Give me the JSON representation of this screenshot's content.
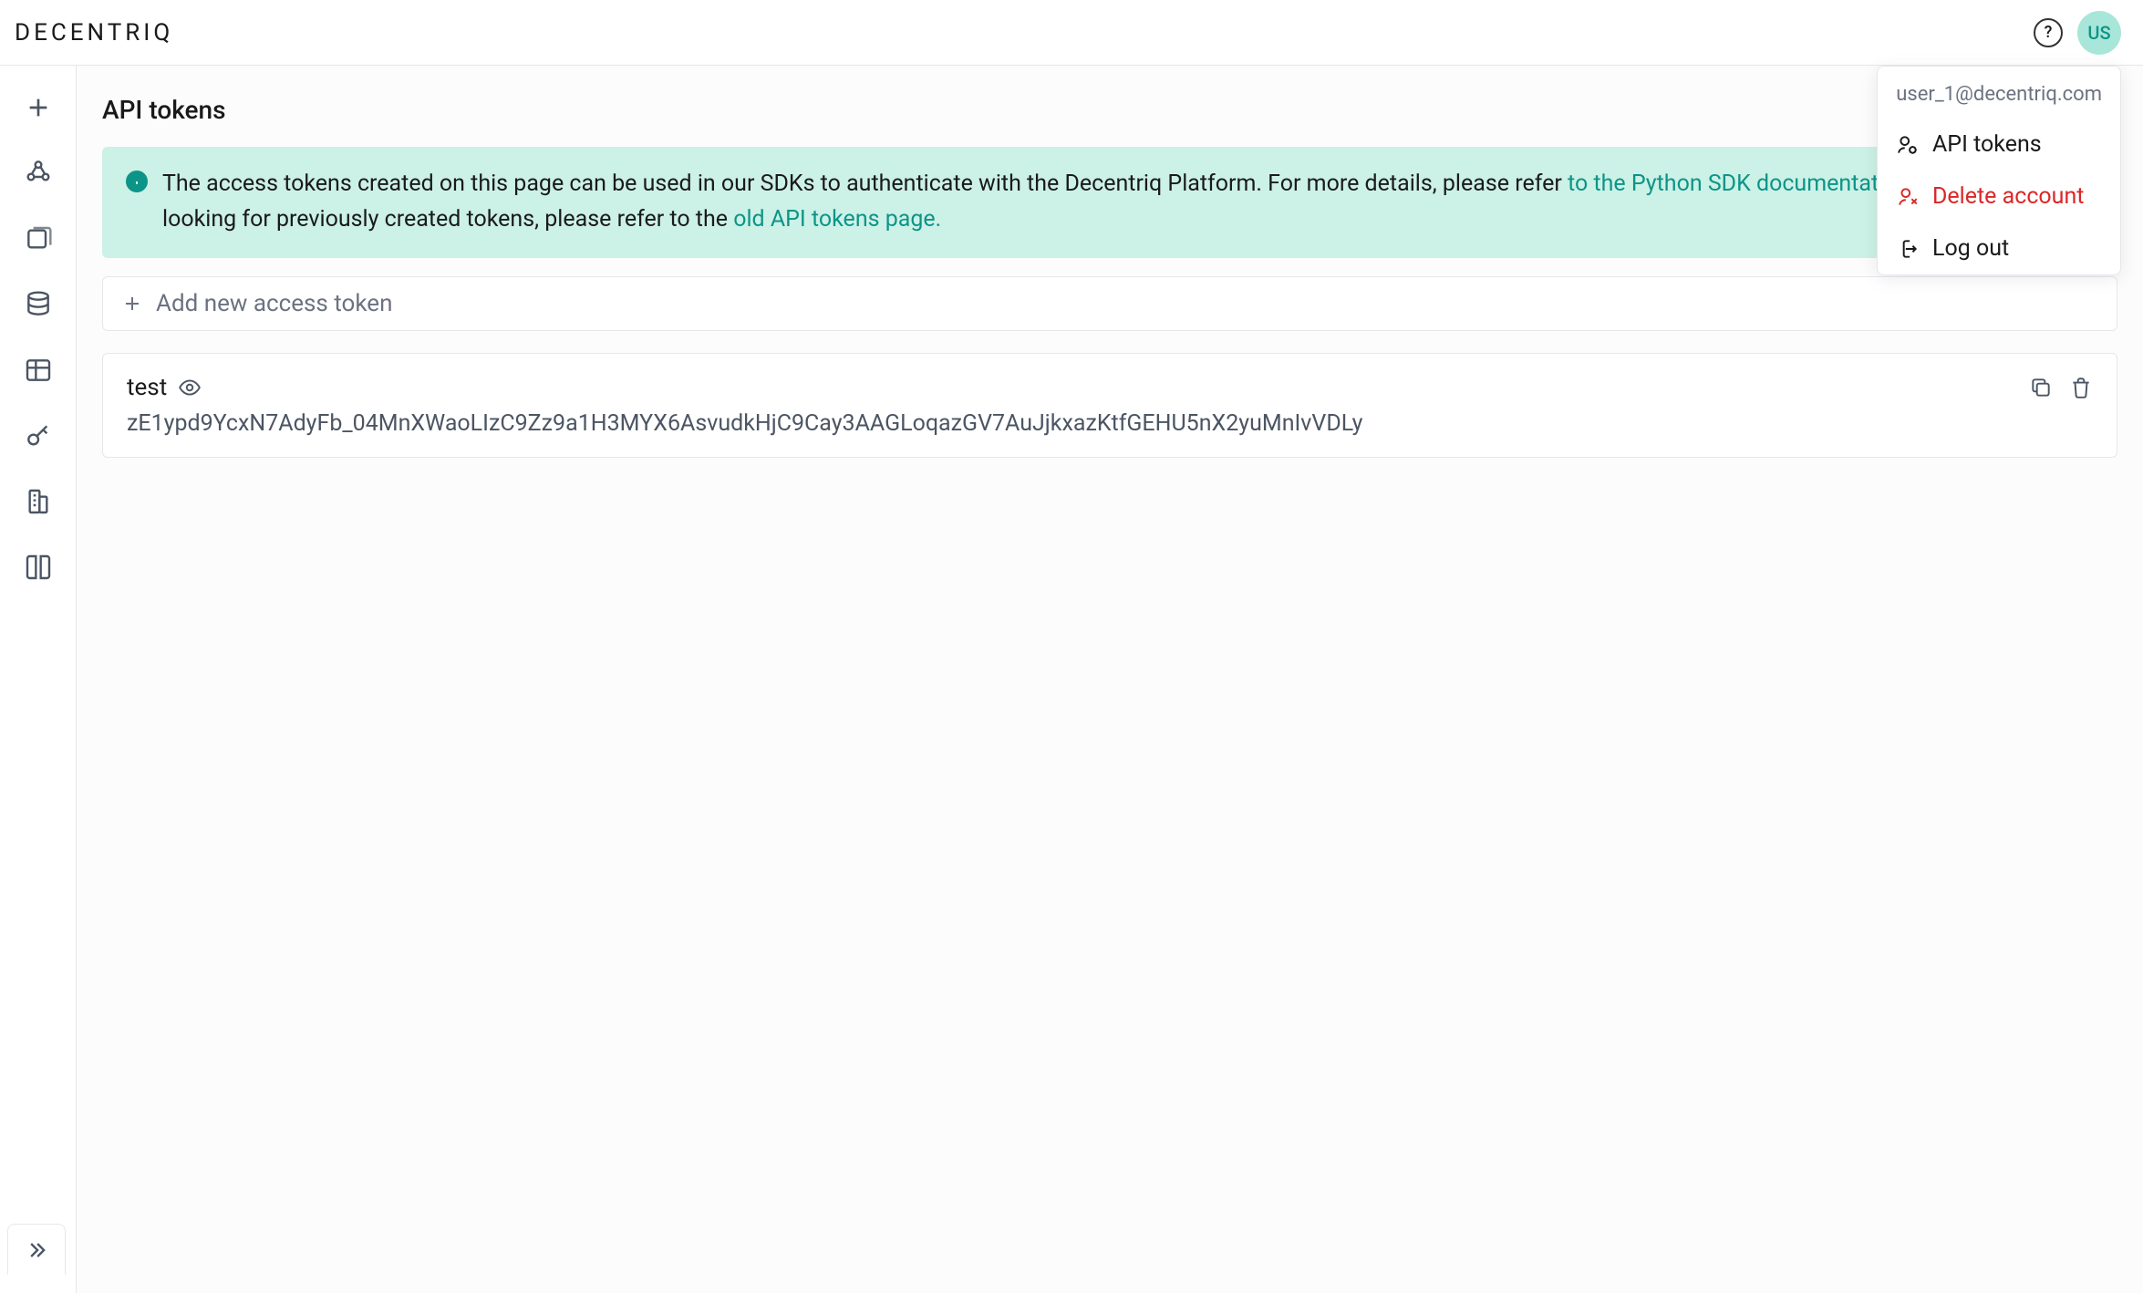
{
  "brand": "DECENTRIQ",
  "header": {
    "avatar_initials": "US"
  },
  "dropdown": {
    "email": "user_1@decentriq.com",
    "api_tokens": "API tokens",
    "delete_account": "Delete account",
    "log_out": "Log out"
  },
  "page": {
    "title": "API tokens"
  },
  "banner": {
    "part1": "The access tokens created on this page can be used in our SDKs to authenticate with the Decentriq Platform. For more details, please refer ",
    "link1": "to the Python SDK documentation.",
    "part2": " If you are looking for previously created tokens, please refer to the ",
    "link2": "old API tokens page."
  },
  "add_token_label": "Add new access token",
  "tokens": [
    {
      "name": "test",
      "value": "zE1ypd9YcxN7AdyFb_04MnXWaoLIzC9Zz9a1H3MYX6AsvudkHjC9Cay3AAGLoqazGV7AuJjkxazKtfGEHU5nX2yuMnIvVDLy"
    }
  ]
}
